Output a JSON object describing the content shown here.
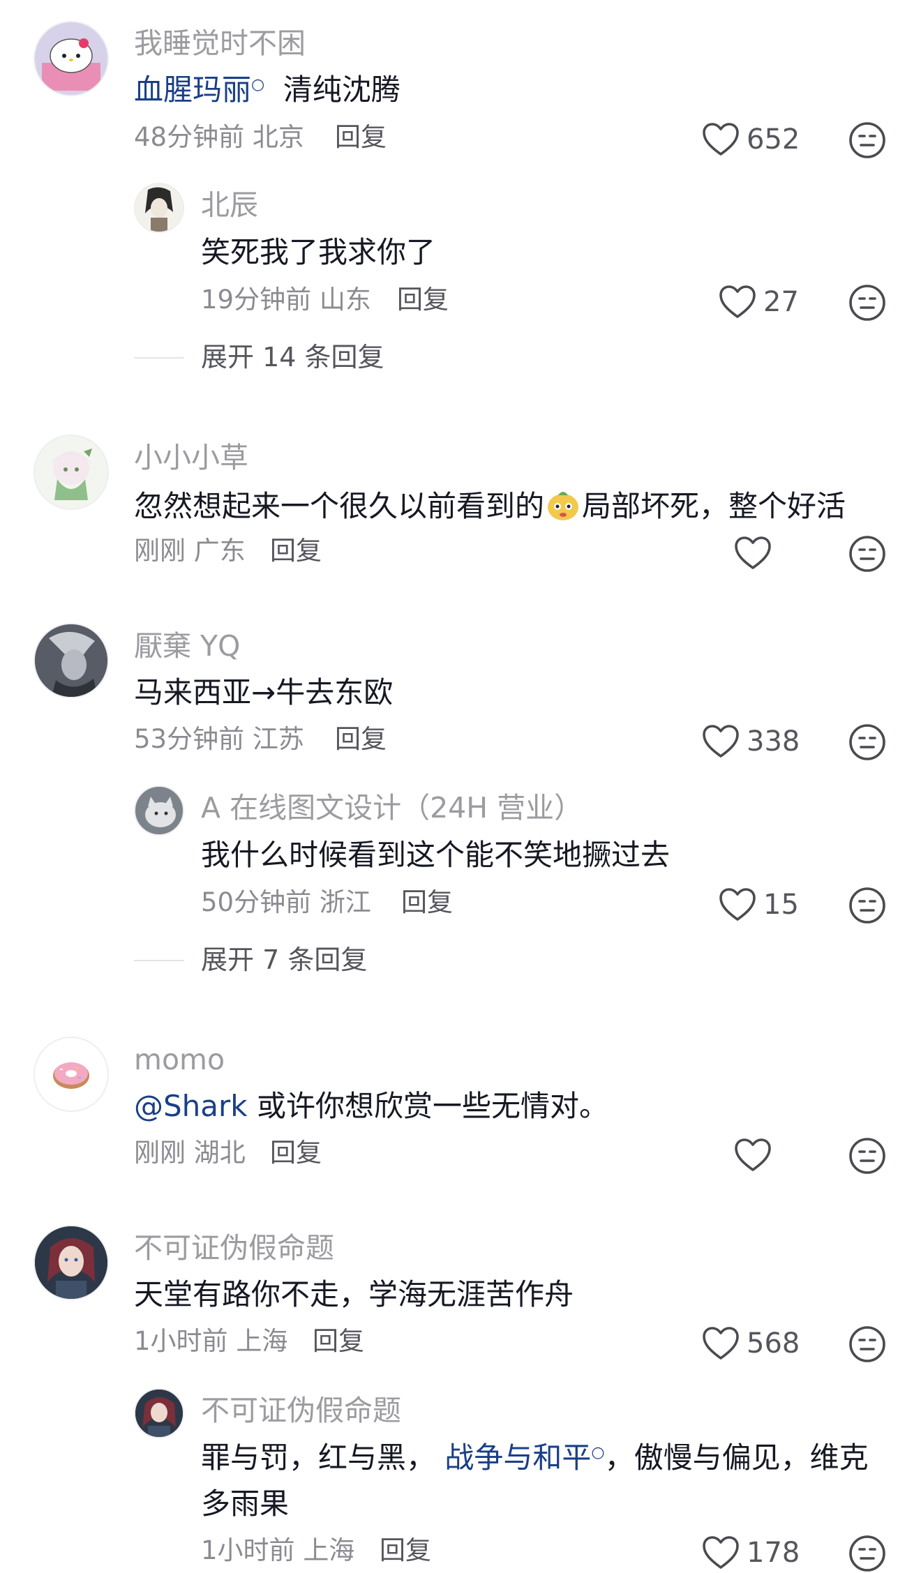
{
  "comments": [
    {
      "username": "我睡觉时不困",
      "link_text": "血腥玛丽",
      "text": "清纯沈腾",
      "time": "48分钟前",
      "location": "北京",
      "reply_label": "回复",
      "likes": "652",
      "replies": [
        {
          "username": "北辰",
          "text": "笑死我了我求你了",
          "time": "19分钟前",
          "location": "山东",
          "reply_label": "回复",
          "likes": "27"
        }
      ],
      "expand_label": "展开 14 条回复"
    },
    {
      "username": "小小小草",
      "text_before": "忽然想起来一个很久以前看到的",
      "text_after": "局部坏死，整个好活",
      "time": "刚刚",
      "location": "广东",
      "reply_label": "回复",
      "likes": ""
    },
    {
      "username": "厭棄 YQ",
      "text": "马来西亚→牛去东欧",
      "time": "53分钟前",
      "location": "江苏",
      "reply_label": "回复",
      "likes": "338",
      "replies": [
        {
          "username": "A 在线图文设计（24H 营业）",
          "text": "我什么时候看到这个能不笑地撅过去",
          "time": "50分钟前",
          "location": "浙江",
          "reply_label": "回复",
          "likes": "15"
        }
      ],
      "expand_label": "展开 7 条回复"
    },
    {
      "username": "momo",
      "mention": "@Shark",
      "text": " 或许你想欣赏一些无情对。",
      "time": "刚刚",
      "location": "湖北",
      "reply_label": "回复",
      "likes": ""
    },
    {
      "username": "不可证伪假命题",
      "text": "天堂有路你不走，学海无涯苦作舟",
      "time": "1小时前",
      "location": "上海",
      "reply_label": "回复",
      "likes": "568",
      "replies": [
        {
          "username": "不可证伪假命题",
          "text_before": "罪与罚，红与黑，",
          "link_text": "战争与和平",
          "text_after": "，傲慢与偏见，维克",
          "text_line2": "多雨果",
          "time": "1小时前",
          "location": "上海",
          "reply_label": "回复",
          "likes": "178"
        }
      ]
    }
  ],
  "icons": {
    "like": "heart-outline-icon",
    "dislike": "neutral-face-icon",
    "search_mark": "search-icon"
  },
  "colors": {
    "link": "#1a3f86",
    "username": "#9b9ba0",
    "meta": "#8a8b91"
  }
}
